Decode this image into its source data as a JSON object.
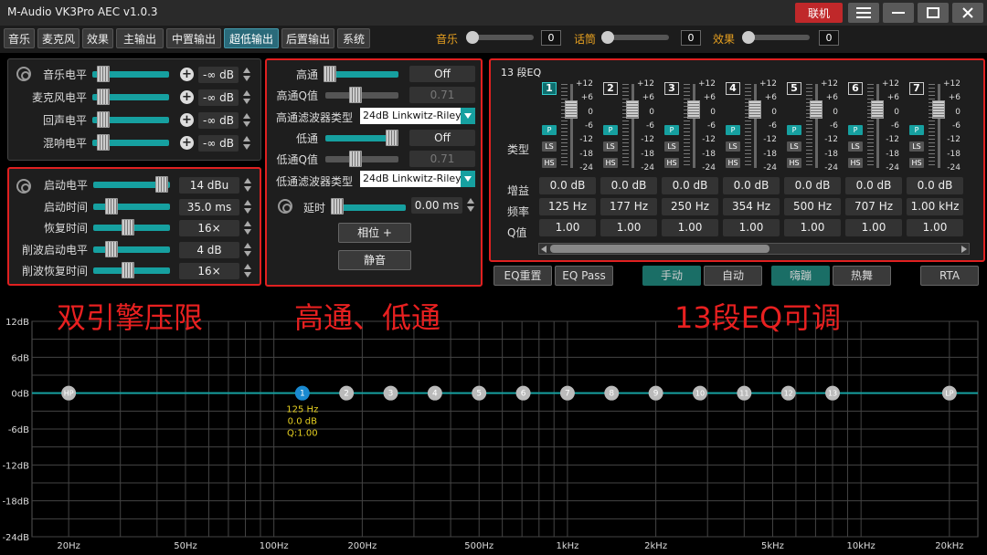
{
  "app": {
    "title": "M-Audio VK3Pro AEC  v1.0.3",
    "connect_label": "联机"
  },
  "tabs": [
    {
      "label": "音乐"
    },
    {
      "label": "麦克风"
    },
    {
      "label": "效果"
    },
    {
      "label": "主输出"
    },
    {
      "label": "中置输出"
    },
    {
      "label": "超低输出",
      "active": true
    },
    {
      "label": "后置输出"
    },
    {
      "label": "系统"
    }
  ],
  "top_sliders": [
    {
      "label": "音乐",
      "value": "0"
    },
    {
      "label": "话筒",
      "value": "0"
    },
    {
      "label": "效果",
      "value": "0"
    }
  ],
  "levels": [
    {
      "label": "音乐电平",
      "value": "-∞ dB",
      "level": 0.1
    },
    {
      "label": "麦克风电平",
      "value": "-∞ dB",
      "level": 0.1
    },
    {
      "label": "回声电平",
      "value": "-∞ dB",
      "level": 0.1
    },
    {
      "label": "混响电平",
      "value": "-∞ dB",
      "level": 0.1
    }
  ],
  "limiter": [
    {
      "label": "启动电平",
      "value": "14 dBu",
      "level": 0.95
    },
    {
      "label": "启动时间",
      "value": "35.0 ms",
      "level": 0.2
    },
    {
      "label": "恢复时间",
      "value": "16×",
      "level": 0.45
    },
    {
      "label": "削波启动电平",
      "value": "4 dB",
      "level": 0.2
    },
    {
      "label": "削波恢复时间",
      "value": "16×",
      "level": 0.45
    }
  ],
  "filters": {
    "highpass_label": "高通",
    "highpass_value": "Off",
    "highpass_q_label": "高通Q值",
    "highpass_q_value": "0.71",
    "highpass_type_label": "高通滤波器类型",
    "highpass_type_value": "24dB Linkwitz-Riley",
    "lowpass_label": "低通",
    "lowpass_value": "Off",
    "lowpass_q_label": "低通Q值",
    "lowpass_q_value": "0.71",
    "lowpass_type_label": "低通滤波器类型",
    "lowpass_type_value": "24dB Linkwitz-Riley",
    "delay_label": "延时",
    "delay_value": "0.00 ms",
    "phase_label": "相位 +",
    "mute_label": "静音"
  },
  "eq": {
    "title": "13 段EQ",
    "type_label": "类型",
    "scale": [
      "+12",
      "+6",
      "0",
      "-6",
      "-12",
      "-18",
      "-24"
    ],
    "type_buttons": [
      "P",
      "LS",
      "HS"
    ],
    "gain_label": "增益",
    "freq_label": "频率",
    "q_label": "Q值",
    "bands": [
      {
        "num": "1",
        "gain": "0.0 dB",
        "freq": "125 Hz",
        "q": "1.00",
        "active": true
      },
      {
        "num": "2",
        "gain": "0.0 dB",
        "freq": "177 Hz",
        "q": "1.00"
      },
      {
        "num": "3",
        "gain": "0.0 dB",
        "freq": "250 Hz",
        "q": "1.00"
      },
      {
        "num": "4",
        "gain": "0.0 dB",
        "freq": "354 Hz",
        "q": "1.00"
      },
      {
        "num": "5",
        "gain": "0.0 dB",
        "freq": "500 Hz",
        "q": "1.00"
      },
      {
        "num": "6",
        "gain": "0.0 dB",
        "freq": "707 Hz",
        "q": "1.00"
      },
      {
        "num": "7",
        "gain": "0.0 dB",
        "freq": "1.00 kHz",
        "q": "1.00"
      }
    ]
  },
  "eq_buttons": {
    "reset": "EQ重置",
    "pass": "EQ Pass",
    "manual": "手动",
    "auto": "自动",
    "dance": "嗨蹦",
    "hot": "热舞",
    "rta": "RTA"
  },
  "annotations": {
    "limiter": "双引擎压限",
    "filters": "高通、低通",
    "eq": "13段EQ可调"
  },
  "graph": {
    "y_labels": [
      "12dB",
      "6dB",
      "0dB",
      "-6dB",
      "-12dB",
      "-18dB",
      "-24dB"
    ],
    "x_labels": [
      "20Hz",
      "50Hz",
      "100Hz",
      "200Hz",
      "500Hz",
      "1kHz",
      "2kHz",
      "5kHz",
      "10kHz",
      "20kHz"
    ],
    "nodes": [
      "HP",
      "1",
      "2",
      "3",
      "4",
      "5",
      "6",
      "7",
      "8",
      "9",
      "10",
      "11",
      "12",
      "13",
      "LP"
    ],
    "tooltip": {
      "freq": "125 Hz",
      "gain": "0.0 dB",
      "q": "Q:1.00"
    },
    "colors": {
      "line": "#16a0a0",
      "active_node": "#1a8ad0",
      "node": "#bbbbbb",
      "tooltip": "#e6d020"
    }
  }
}
